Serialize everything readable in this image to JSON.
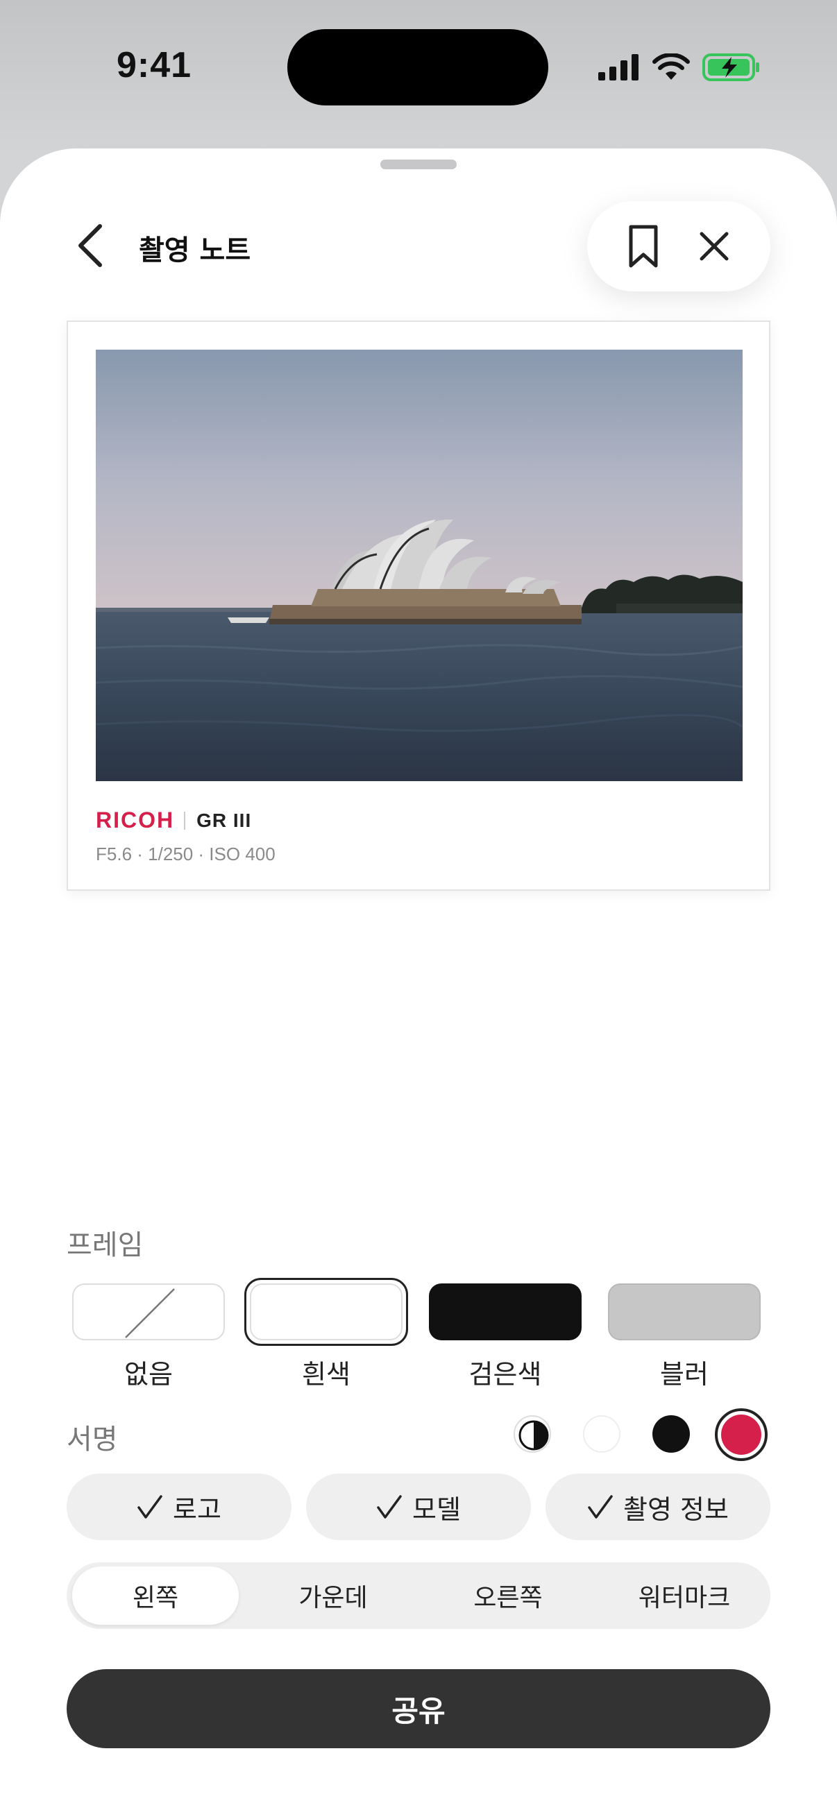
{
  "status_bar": {
    "time": "9:41"
  },
  "header": {
    "title": "촬영 노트"
  },
  "preview": {
    "brand": "RICOH",
    "model": "GR III",
    "exif": "F5.6 · 1/250 · ISO 400"
  },
  "frame": {
    "label": "프레임",
    "options": [
      "없음",
      "흰색",
      "검은색",
      "블러"
    ],
    "selected": "흰색"
  },
  "signature": {
    "label": "서명",
    "colors": [
      "#111111",
      "#ffffff",
      "#111111",
      "#d6204c"
    ],
    "selected_color": "#d6204c",
    "toggles": [
      "로고",
      "모델",
      "촬영 정보"
    ],
    "alignment_options": [
      "왼쪽",
      "가운데",
      "오른쪽",
      "워터마크"
    ],
    "selected_alignment": "왼쪽"
  },
  "share_button": "공유"
}
